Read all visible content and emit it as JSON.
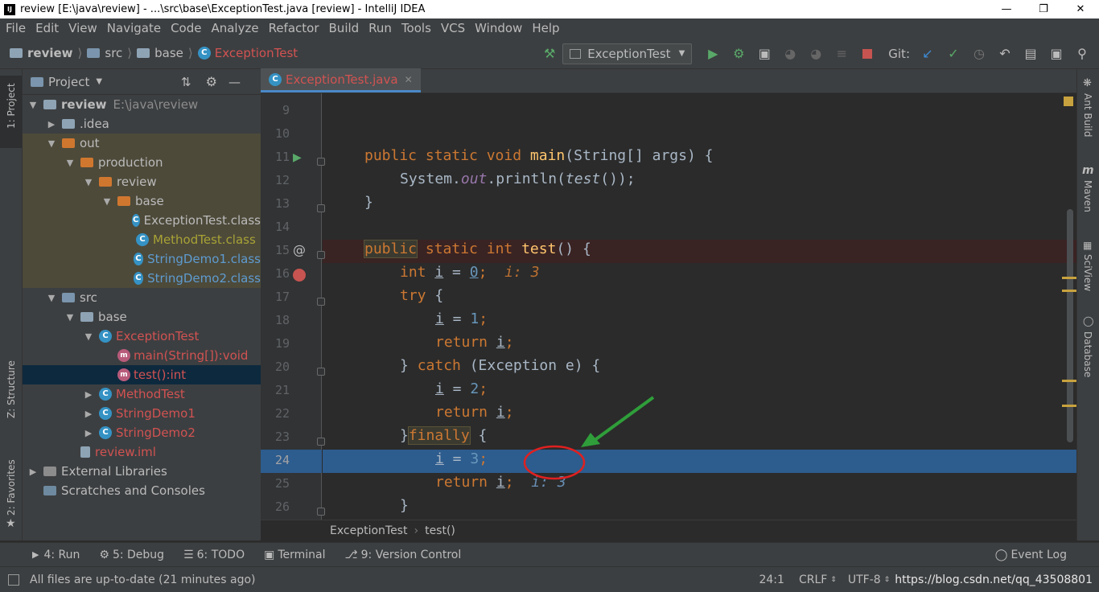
{
  "window": {
    "title": "review [E:\\java\\review] - ...\\src\\base\\ExceptionTest.java [review] - IntelliJ IDEA",
    "logo": "IJ"
  },
  "menu": [
    "File",
    "Edit",
    "View",
    "Navigate",
    "Code",
    "Analyze",
    "Refactor",
    "Build",
    "Run",
    "Tools",
    "VCS",
    "Window",
    "Help"
  ],
  "nav": {
    "project": "review",
    "folder1": "src",
    "folder2": "base",
    "file": "ExceptionTest",
    "run_config": "ExceptionTest",
    "git_label": "Git:"
  },
  "project_panel": {
    "title": "Project"
  },
  "tree": [
    {
      "label": "review",
      "extra": "E:\\java\\review",
      "indent": 0,
      "arrow": "▼",
      "icon": "folder",
      "color": "#bbbbbb",
      "bold": true
    },
    {
      "label": ".idea",
      "indent": 1,
      "arrow": "▶",
      "icon": "folder",
      "color": "#bbbbbb"
    },
    {
      "label": "out",
      "indent": 1,
      "arrow": "▼",
      "icon": "folder-orange",
      "color": "#bbbbbb",
      "excluded": true
    },
    {
      "label": "production",
      "indent": 2,
      "arrow": "▼",
      "icon": "folder-orange",
      "color": "#bbbbbb",
      "excluded": true
    },
    {
      "label": "review",
      "indent": 3,
      "arrow": "▼",
      "icon": "folder-orange",
      "color": "#bbbbbb",
      "excluded": true
    },
    {
      "label": "base",
      "indent": 4,
      "arrow": "▼",
      "icon": "folder-orange",
      "color": "#bbbbbb",
      "excluded": true
    },
    {
      "label": "ExceptionTest.class",
      "indent": 5,
      "arrow": "",
      "icon": "class",
      "color": "#bbbbbb",
      "excluded": true
    },
    {
      "label": "MethodTest.class",
      "indent": 5,
      "arrow": "",
      "icon": "class",
      "color": "#a8a235",
      "excluded": true
    },
    {
      "label": "StringDemo1.class",
      "indent": 5,
      "arrow": "",
      "icon": "class",
      "color": "#5e9bd0",
      "excluded": true
    },
    {
      "label": "StringDemo2.class",
      "indent": 5,
      "arrow": "",
      "icon": "class",
      "color": "#5e9bd0",
      "excluded": true
    },
    {
      "label": "src",
      "indent": 1,
      "arrow": "▼",
      "icon": "folder-blue",
      "color": "#bbbbbb"
    },
    {
      "label": "base",
      "indent": 2,
      "arrow": "▼",
      "icon": "folder",
      "color": "#bbbbbb"
    },
    {
      "label": "ExceptionTest",
      "indent": 3,
      "arrow": "▼",
      "icon": "class",
      "color": "#d25252"
    },
    {
      "label": "main(String[]):void",
      "indent": 4,
      "arrow": "",
      "icon": "method",
      "color": "#d25252"
    },
    {
      "label": "test():int",
      "indent": 4,
      "arrow": "",
      "icon": "method",
      "color": "#d25252",
      "selected": true
    },
    {
      "label": "MethodTest",
      "indent": 3,
      "arrow": "▶",
      "icon": "class",
      "color": "#d25252"
    },
    {
      "label": "StringDemo1",
      "indent": 3,
      "arrow": "▶",
      "icon": "class",
      "color": "#d25252"
    },
    {
      "label": "StringDemo2",
      "indent": 3,
      "arrow": "▶",
      "icon": "class",
      "color": "#d25252"
    },
    {
      "label": "review.iml",
      "indent": 2,
      "arrow": "",
      "icon": "file",
      "color": "#d25252"
    },
    {
      "label": "External Libraries",
      "indent": 0,
      "arrow": "▶",
      "icon": "lib",
      "color": "#bbbbbb"
    },
    {
      "label": "Scratches and Consoles",
      "indent": 0,
      "arrow": "",
      "icon": "scratch",
      "color": "#bbbbbb"
    }
  ],
  "editor": {
    "tab": "ExceptionTest.java",
    "line_numbers": [
      "9",
      "10",
      "11",
      "12",
      "13",
      "14",
      "15",
      "16",
      "17",
      "18",
      "19",
      "20",
      "21",
      "22",
      "23",
      "24",
      "25",
      "26"
    ],
    "code": {
      "l10_a": "public static void ",
      "l10_fn": "main",
      "l10_b": "(String[] args) {",
      "l11_a": "System.",
      "l11_out": "out",
      "l11_b": ".println(",
      "l11_test": "test",
      "l11_c": "());",
      "l12": "}",
      "l14_pub": "public",
      "l14_a": " static int ",
      "l14_fn": "test",
      "l14_b": "() {",
      "l15_kw": "int ",
      "l15_i": "i",
      "l15_eq": " = ",
      "l15_num": "0",
      "l15_semi": ";",
      "l15_hint": "i: 3",
      "l16_kw": "try",
      "l16_b": " {",
      "l17_i": "i",
      "l17_eq": " = ",
      "l17_num": "1",
      "l17_semi": ";",
      "l18_kw": "return ",
      "l18_i": "i",
      "l18_semi": ";",
      "l19_a": "} ",
      "l19_kw": "catch",
      "l19_b": " (Exception e) {",
      "l20_i": "i",
      "l20_eq": " = ",
      "l20_num": "2",
      "l20_semi": ";",
      "l21_kw": "return ",
      "l21_i": "i",
      "l21_semi": ";",
      "l22_a": "}",
      "l22_kw": "finally",
      "l22_b": " {",
      "l23_i": "i",
      "l23_eq": " = ",
      "l23_num": "3",
      "l23_semi": ";",
      "l24_kw": "return ",
      "l24_i": "i",
      "l24_semi": ";",
      "l24_hint": "i: 3",
      "l25": "}",
      "l26": "}"
    },
    "breadcrumb": {
      "cls": "ExceptionTest",
      "sep": "›",
      "method": "test()"
    }
  },
  "left_tabs": {
    "project": "1: Project",
    "structure": "Z: Structure",
    "favorites": "2: Favorites"
  },
  "right_tabs": {
    "ant": "Ant Build",
    "maven": "Maven",
    "sciview": "SciView",
    "database": "Database"
  },
  "bottom_tabs": {
    "run": "4: Run",
    "debug": "5: Debug",
    "todo": "6: TODO",
    "terminal": "Terminal",
    "vcs": "9: Version Control",
    "event_log": "Event Log"
  },
  "status": {
    "message": "All files are up-to-date (21 minutes ago)",
    "position": "24:1",
    "line_sep": "CRLF",
    "encoding": "UTF-8",
    "watermark": "https://blog.csdn.net/qq_43508801"
  },
  "colors": {
    "accent": "#4a88c7",
    "current_line": "#2d5c8e",
    "breakpoint_line": "#3a2323",
    "annotation_red": "#e02020",
    "annotation_green": "#2f9e3a"
  }
}
